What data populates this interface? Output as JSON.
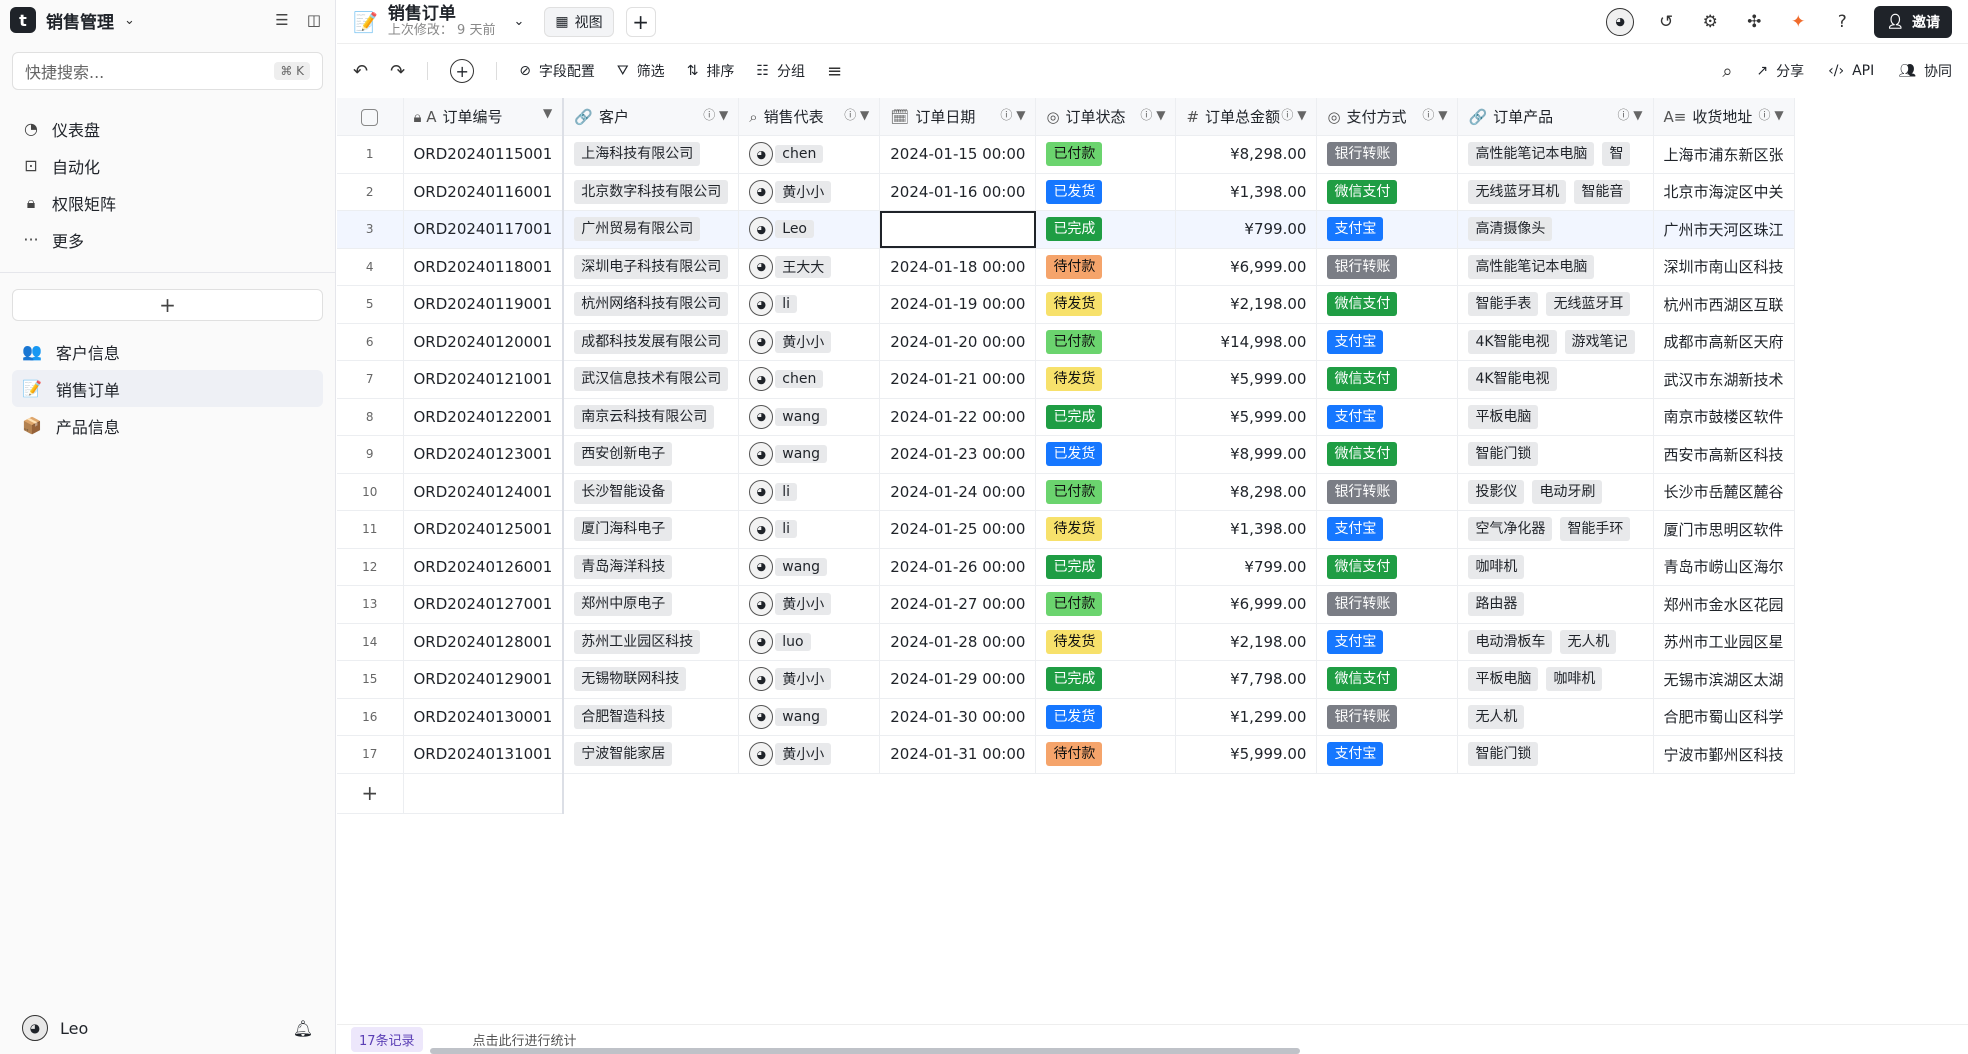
{
  "sidebar": {
    "app_logo": "t",
    "app_title": "销售管理",
    "search_placeholder": "快捷搜索...",
    "search_shortcut": "⌘ K",
    "nav": [
      {
        "icon": "dashboard-icon",
        "glyph": "◔",
        "label": "仪表盘"
      },
      {
        "icon": "robot-icon",
        "glyph": "⊡",
        "label": "自动化"
      },
      {
        "icon": "lock-icon",
        "glyph": "🔒︎",
        "label": "权限矩阵"
      },
      {
        "icon": "more-icon",
        "glyph": "···",
        "label": "更多"
      }
    ],
    "add_label": "+",
    "tables": [
      {
        "icon": "people-icon",
        "glyph": "👥",
        "label": "客户信息"
      },
      {
        "icon": "memo-icon",
        "glyph": "📝",
        "label": "销售订单"
      },
      {
        "icon": "package-icon",
        "glyph": "📦",
        "label": "产品信息"
      }
    ],
    "user_name": "Leo"
  },
  "topbar": {
    "doc_emoji": "📝",
    "doc_title": "销售订单",
    "doc_subtitle": "上次修改： 9 天前",
    "view_label": "视图",
    "invite_label": "邀请"
  },
  "toolbar": {
    "field_config": "字段配置",
    "filter": "筛选",
    "sort": "排序",
    "group": "分组",
    "share": "分享",
    "api": "API",
    "collab": "协同"
  },
  "columns": [
    {
      "icon": "🔒︎ A",
      "label": "订单编号"
    },
    {
      "icon": "🔗",
      "label": "客户"
    },
    {
      "icon": "⌕",
      "label": "销售代表"
    },
    {
      "icon": "🗓",
      "label": "订单日期"
    },
    {
      "icon": "◎",
      "label": "订单状态"
    },
    {
      "icon": "#",
      "label": "订单总金额"
    },
    {
      "icon": "◎",
      "label": "支付方式"
    },
    {
      "icon": "🔗",
      "label": "订单产品"
    },
    {
      "icon": "A≡",
      "label": "收货地址"
    }
  ],
  "rows": [
    {
      "n": "1",
      "id": "ORD20240115001",
      "customer": "上海科技有限公司",
      "rep": "chen",
      "date": "2024-01-15 00:00",
      "status": "已付款",
      "amount": "¥8,298.00",
      "pay": "银行转账",
      "products": [
        "高性能笔记本电脑",
        "智"
      ],
      "addr": "上海市浦东新区张"
    },
    {
      "n": "2",
      "id": "ORD20240116001",
      "customer": "北京数字科技有限公司",
      "rep": "黄小小",
      "date": "2024-01-16 00:00",
      "status": "已发货",
      "amount": "¥1,398.00",
      "pay": "微信支付",
      "products": [
        "无线蓝牙耳机",
        "智能音"
      ],
      "addr": "北京市海淀区中关"
    },
    {
      "n": "3",
      "id": "ORD20240117001",
      "customer": "广州贸易有限公司",
      "rep": "Leo",
      "date": "",
      "status": "已完成",
      "amount": "¥799.00",
      "pay": "支付宝",
      "products": [
        "高清摄像头"
      ],
      "addr": "广州市天河区珠江"
    },
    {
      "n": "4",
      "id": "ORD20240118001",
      "customer": "深圳电子科技有限公司",
      "rep": "王大大",
      "date": "2024-01-18 00:00",
      "status": "待付款",
      "amount": "¥6,999.00",
      "pay": "银行转账",
      "products": [
        "高性能笔记本电脑"
      ],
      "addr": "深圳市南山区科技"
    },
    {
      "n": "5",
      "id": "ORD20240119001",
      "customer": "杭州网络科技有限公司",
      "rep": "li",
      "date": "2024-01-19 00:00",
      "status": "待发货",
      "amount": "¥2,198.00",
      "pay": "微信支付",
      "products": [
        "智能手表",
        "无线蓝牙耳"
      ],
      "addr": "杭州市西湖区互联"
    },
    {
      "n": "6",
      "id": "ORD20240120001",
      "customer": "成都科技发展有限公司",
      "rep": "黄小小",
      "date": "2024-01-20 00:00",
      "status": "已付款",
      "amount": "¥14,998.00",
      "pay": "支付宝",
      "products": [
        "4K智能电视",
        "游戏笔记"
      ],
      "addr": "成都市高新区天府"
    },
    {
      "n": "7",
      "id": "ORD20240121001",
      "customer": "武汉信息技术有限公司",
      "rep": "chen",
      "date": "2024-01-21 00:00",
      "status": "待发货",
      "amount": "¥5,999.00",
      "pay": "微信支付",
      "products": [
        "4K智能电视"
      ],
      "addr": "武汉市东湖新技术"
    },
    {
      "n": "8",
      "id": "ORD20240122001",
      "customer": "南京云科技有限公司",
      "rep": "wang",
      "date": "2024-01-22 00:00",
      "status": "已完成",
      "amount": "¥5,999.00",
      "pay": "支付宝",
      "products": [
        "平板电脑"
      ],
      "addr": "南京市鼓楼区软件"
    },
    {
      "n": "9",
      "id": "ORD20240123001",
      "customer": "西安创新电子",
      "rep": "wang",
      "date": "2024-01-23 00:00",
      "status": "已发货",
      "amount": "¥8,999.00",
      "pay": "微信支付",
      "products": [
        "智能门锁"
      ],
      "addr": "西安市高新区科技"
    },
    {
      "n": "10",
      "id": "ORD20240124001",
      "customer": "长沙智能设备",
      "rep": "li",
      "date": "2024-01-24 00:00",
      "status": "已付款",
      "amount": "¥8,298.00",
      "pay": "银行转账",
      "products": [
        "投影仪",
        "电动牙刷"
      ],
      "addr": "长沙市岳麓区麓谷"
    },
    {
      "n": "11",
      "id": "ORD20240125001",
      "customer": "厦门海科电子",
      "rep": "li",
      "date": "2024-01-25 00:00",
      "status": "待发货",
      "amount": "¥1,398.00",
      "pay": "支付宝",
      "products": [
        "空气净化器",
        "智能手环"
      ],
      "addr": "厦门市思明区软件"
    },
    {
      "n": "12",
      "id": "ORD20240126001",
      "customer": "青岛海洋科技",
      "rep": "wang",
      "date": "2024-01-26 00:00",
      "status": "已完成",
      "amount": "¥799.00",
      "pay": "微信支付",
      "products": [
        "咖啡机"
      ],
      "addr": "青岛市崂山区海尔"
    },
    {
      "n": "13",
      "id": "ORD20240127001",
      "customer": "郑州中原电子",
      "rep": "黄小小",
      "date": "2024-01-27 00:00",
      "status": "已付款",
      "amount": "¥6,999.00",
      "pay": "银行转账",
      "products": [
        "路由器"
      ],
      "addr": "郑州市金水区花园"
    },
    {
      "n": "14",
      "id": "ORD20240128001",
      "customer": "苏州工业园区科技",
      "rep": "luo",
      "date": "2024-01-28 00:00",
      "status": "待发货",
      "amount": "¥2,198.00",
      "pay": "支付宝",
      "products": [
        "电动滑板车",
        "无人机"
      ],
      "addr": "苏州市工业园区星"
    },
    {
      "n": "15",
      "id": "ORD20240129001",
      "customer": "无锡物联网科技",
      "rep": "黄小小",
      "date": "2024-01-29 00:00",
      "status": "已完成",
      "amount": "¥7,798.00",
      "pay": "微信支付",
      "products": [
        "平板电脑",
        "咖啡机"
      ],
      "addr": "无锡市滨湖区太湖"
    },
    {
      "n": "16",
      "id": "ORD20240130001",
      "customer": "合肥智造科技",
      "rep": "wang",
      "date": "2024-01-30 00:00",
      "status": "已发货",
      "amount": "¥1,299.00",
      "pay": "银行转账",
      "products": [
        "无人机"
      ],
      "addr": "合肥市蜀山区科学"
    },
    {
      "n": "17",
      "id": "ORD20240131001",
      "customer": "宁波智能家居",
      "rep": "黄小小",
      "date": "2024-01-31 00:00",
      "status": "待付款",
      "amount": "¥5,999.00",
      "pay": "支付宝",
      "products": [
        "智能门锁"
      ],
      "addr": "宁波市鄞州区科技"
    }
  ],
  "footer": {
    "record_count": "17条记录",
    "stat_hint": "点击此行进行统计"
  },
  "colors": {
    "accent": "#1f2329",
    "paid": "#6bd46e",
    "shipped": "#1677ff",
    "done": "#1f9d44",
    "unpaid": "#f5a46b",
    "pending": "#f7e16b"
  }
}
